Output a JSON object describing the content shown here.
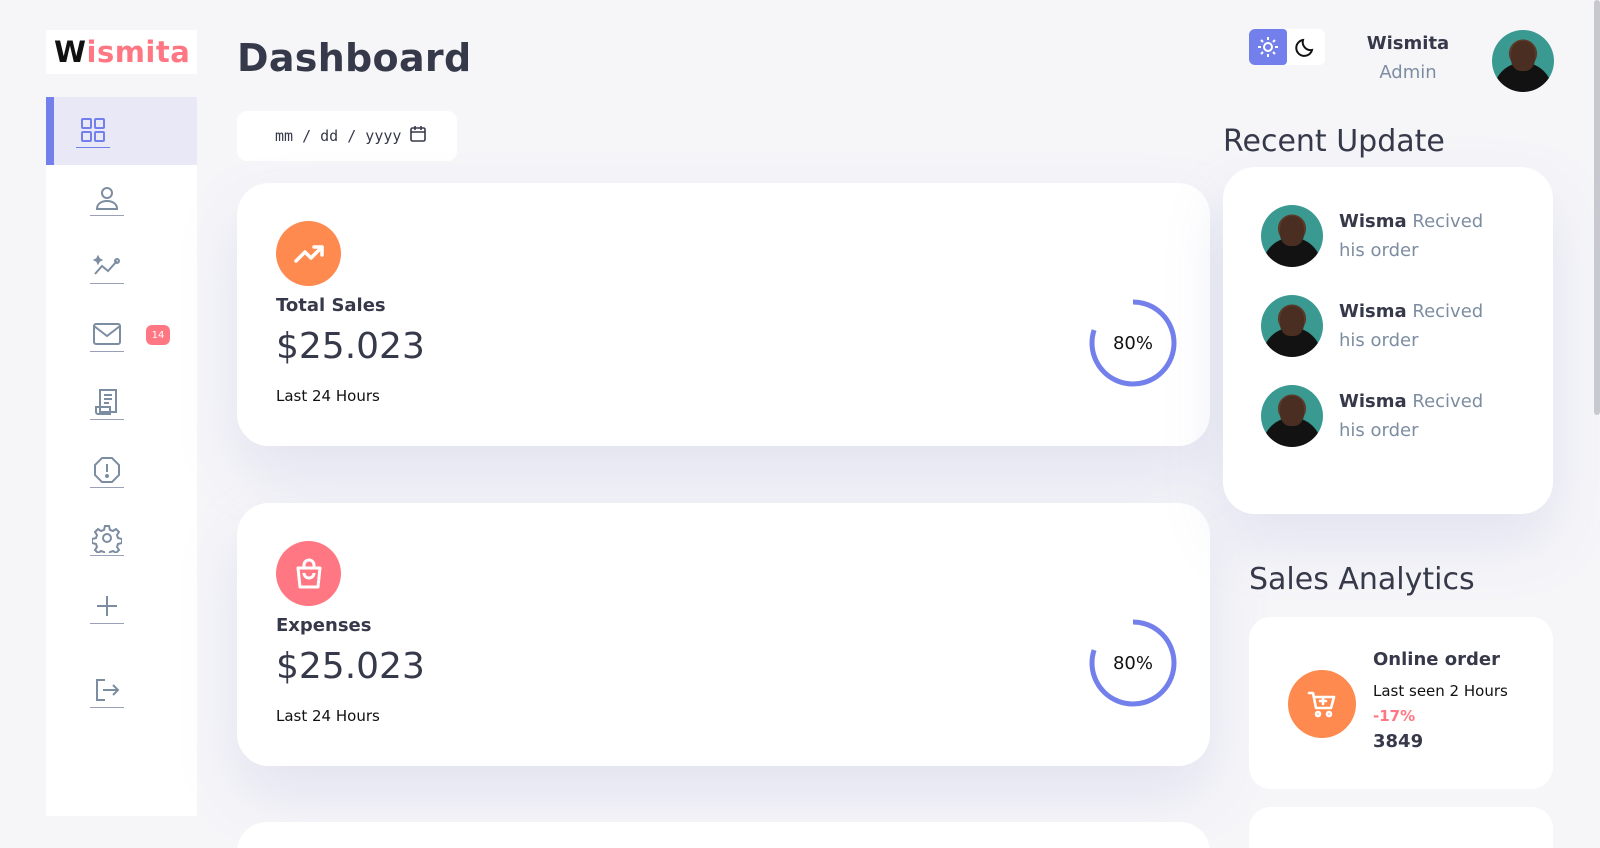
{
  "brand": {
    "first": "W",
    "rest": "ismita"
  },
  "sidebar": {
    "items": [
      {
        "name": "dashboard",
        "icon": "grid-icon",
        "active": true
      },
      {
        "name": "customers",
        "icon": "person-icon"
      },
      {
        "name": "analytics",
        "icon": "insights-icon"
      },
      {
        "name": "messages",
        "icon": "mail-icon",
        "badge": "14"
      },
      {
        "name": "products",
        "icon": "receipt-icon"
      },
      {
        "name": "reports",
        "icon": "report-icon"
      },
      {
        "name": "settings",
        "icon": "gear-icon"
      },
      {
        "name": "add-product",
        "icon": "plus-icon"
      },
      {
        "name": "logout",
        "icon": "logout-icon"
      }
    ]
  },
  "header": {
    "title": "Dashboard"
  },
  "date_input": {
    "placeholder": "mm / dd / yyyy"
  },
  "cards": [
    {
      "label": "Total Sales",
      "value": "$25.023",
      "sub": "Last 24 Hours",
      "percent": "80%",
      "progress": 0.8,
      "icon": "trending-up-icon",
      "color": "#ff8a50"
    },
    {
      "label": "Expenses",
      "value": "$25.023",
      "sub": "Last 24 Hours",
      "percent": "80%",
      "progress": 0.8,
      "icon": "shopping-bag-icon",
      "color": "#ff7782"
    }
  ],
  "user": {
    "name": "Wismita",
    "role": "Admin"
  },
  "theme": {
    "light_icon": "sun-icon",
    "dark_icon": "moon-icon",
    "accent": "#7380ec"
  },
  "recent_updates": {
    "title": "Recent Update",
    "items": [
      {
        "name": "Wisma",
        "text": "Recived his order"
      },
      {
        "name": "Wisma",
        "text": "Recived his order"
      },
      {
        "name": "Wisma",
        "text": "Recived his order"
      }
    ]
  },
  "sales_analytics": {
    "title": "Sales Analytics",
    "items": [
      {
        "title": "Online order",
        "sub": "Last seen 2 Hours",
        "delta": "-17%",
        "count": "3849",
        "icon": "cart-icon"
      }
    ]
  }
}
